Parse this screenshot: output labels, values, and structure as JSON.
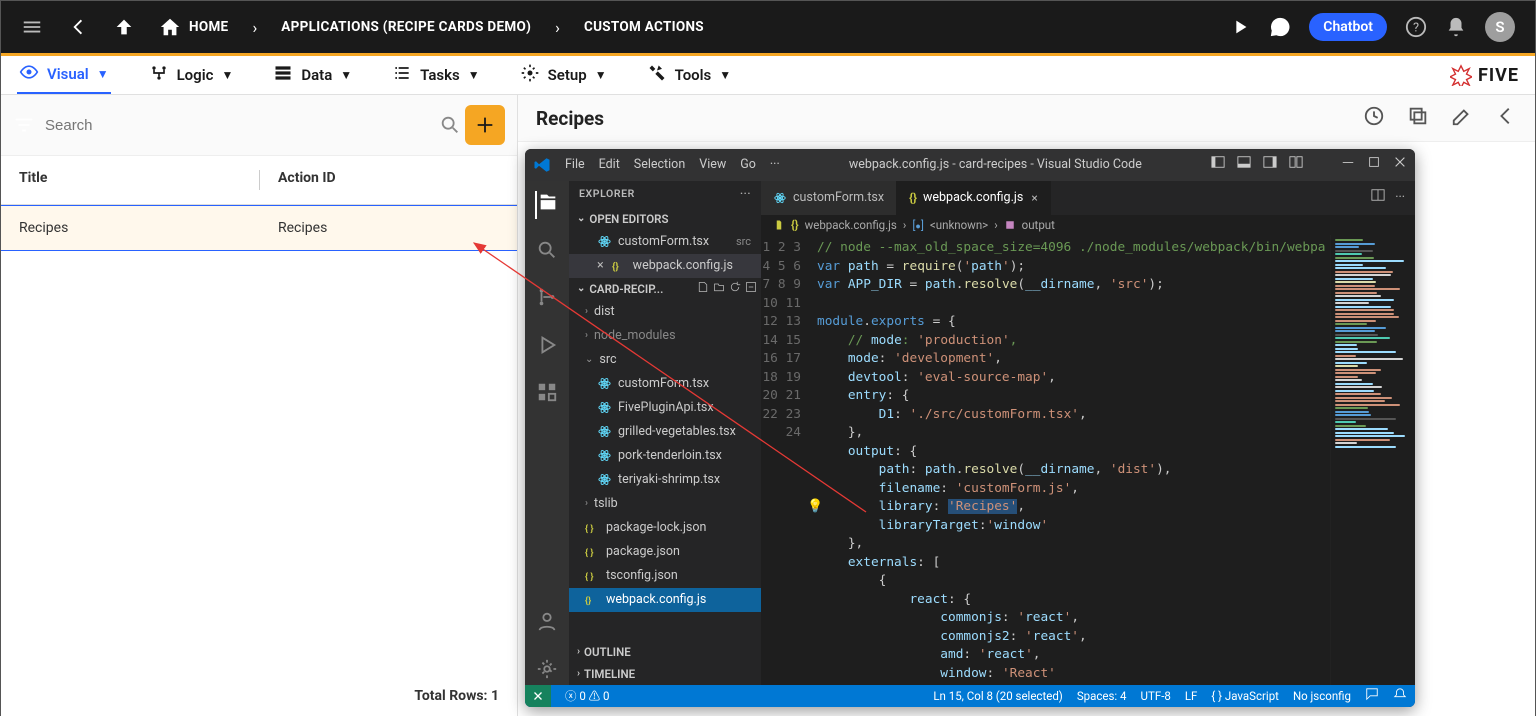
{
  "topbar": {
    "home": "HOME",
    "crumb1": "APPLICATIONS (RECIPE CARDS DEMO)",
    "crumb2": "CUSTOM ACTIONS",
    "chatbot": "Chatbot",
    "avatar_letter": "S"
  },
  "nav_tabs": {
    "visual": "Visual",
    "logic": "Logic",
    "data": "Data",
    "tasks": "Tasks",
    "setup": "Setup",
    "tools": "Tools",
    "brand": "FIVE"
  },
  "left": {
    "search_placeholder": "Search",
    "col_title": "Title",
    "col_actionid": "Action ID",
    "row_title": "Recipes",
    "row_actionid": "Recipes",
    "footer": "Total Rows: 1"
  },
  "right": {
    "title": "Recipes"
  },
  "vscode": {
    "menus": [
      "File",
      "Edit",
      "Selection",
      "View",
      "Go"
    ],
    "window_title": "webpack.config.js - card-recipes - Visual Studio Code",
    "explorer_label": "EXPLORER",
    "open_editors_label": "OPEN EDITORS",
    "open_editors": [
      {
        "name": "customForm.tsx",
        "hint": "src"
      },
      {
        "name": "webpack.config.js",
        "hint": ""
      }
    ],
    "project_label": "CARD-RECIP...",
    "tree": [
      {
        "lvl": 1,
        "type": "folder",
        "name": "dist",
        "open": false
      },
      {
        "lvl": 1,
        "type": "folder",
        "name": "node_modules",
        "open": false,
        "dim": true
      },
      {
        "lvl": 1,
        "type": "folder",
        "name": "src",
        "open": true
      },
      {
        "lvl": 2,
        "type": "react",
        "name": "customForm.tsx"
      },
      {
        "lvl": 2,
        "type": "react",
        "name": "FivePluginApi.tsx"
      },
      {
        "lvl": 2,
        "type": "react",
        "name": "grilled-vegetables.tsx"
      },
      {
        "lvl": 2,
        "type": "react",
        "name": "pork-tenderloin.tsx"
      },
      {
        "lvl": 2,
        "type": "react",
        "name": "teriyaki-shrimp.tsx"
      },
      {
        "lvl": 1,
        "type": "folder",
        "name": "tslib",
        "open": false
      },
      {
        "lvl": 1,
        "type": "json",
        "name": "package-lock.json"
      },
      {
        "lvl": 1,
        "type": "json",
        "name": "package.json"
      },
      {
        "lvl": 1,
        "type": "json",
        "name": "tsconfig.json"
      },
      {
        "lvl": 1,
        "type": "js",
        "name": "webpack.config.js",
        "sel": true
      }
    ],
    "outline_label": "OUTLINE",
    "timeline_label": "TIMELINE",
    "tabs": [
      {
        "name": "customForm.tsx",
        "icon": "react",
        "active": false
      },
      {
        "name": "webpack.config.js",
        "icon": "js",
        "active": true
      }
    ],
    "breadcrumb": [
      "webpack.config.js",
      "<unknown>",
      "output"
    ],
    "code": [
      "// node --max_old_space_size=4096 ./node_modules/webpack/bin/webpa",
      "var path = require('path');",
      "var APP_DIR = path.resolve(__dirname, 'src');",
      "",
      "module.exports = {",
      "    // mode: 'production',",
      "    mode: 'development',",
      "    devtool: 'eval-source-map',",
      "    entry: {",
      "        D1: './src/customForm.tsx',",
      "    },",
      "    output: {",
      "        path: path.resolve(__dirname, 'dist'),",
      "        filename: 'customForm.js',",
      "        library: 'Recipes',",
      "        libraryTarget:'window'",
      "    },",
      "    externals: [",
      "        {",
      "            react: {",
      "                commonjs: 'react',",
      "                commonjs2: 'react',",
      "                amd: 'react',",
      "                window: 'React'"
    ],
    "status": {
      "warn": "0",
      "err": "0",
      "pos": "Ln 15, Col 8 (20 selected)",
      "spaces": "Spaces: 4",
      "enc": "UTF-8",
      "eol": "LF",
      "lang": "JavaScript",
      "jsconfig": "No jsconfig"
    }
  }
}
